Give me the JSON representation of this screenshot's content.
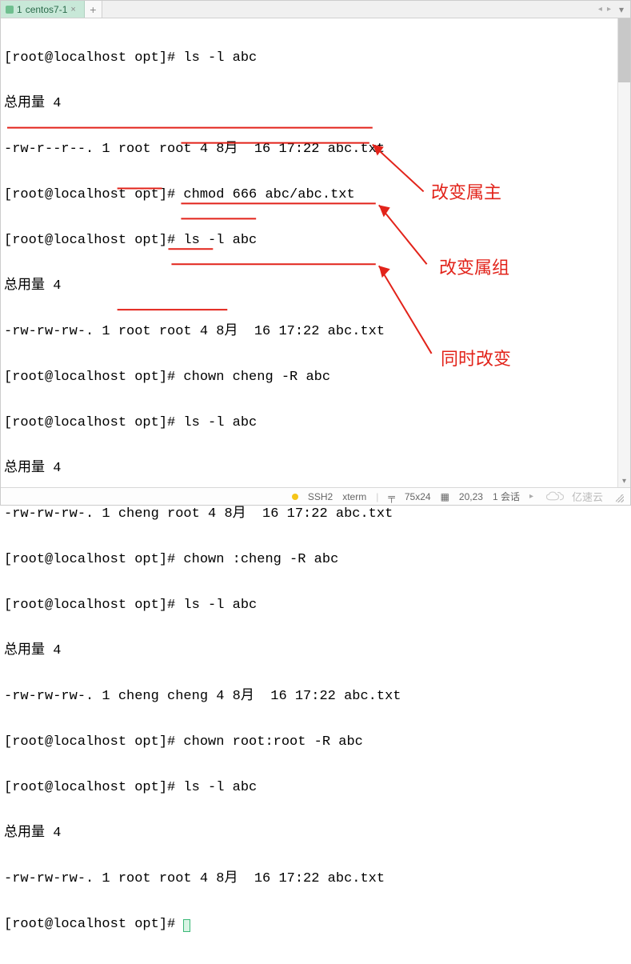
{
  "tab": {
    "index": "1",
    "title": "centos7-1"
  },
  "terminal": {
    "lines": [
      "[root@localhost opt]# ls -l abc",
      "总用量 4",
      "-rw-r--r--. 1 root root 4 8月  16 17:22 abc.txt",
      "[root@localhost opt]# chmod 666 abc/abc.txt",
      "[root@localhost opt]# ls -l abc",
      "总用量 4",
      "-rw-rw-rw-. 1 root root 4 8月  16 17:22 abc.txt",
      "[root@localhost opt]# chown cheng -R abc",
      "[root@localhost opt]# ls -l abc",
      "总用量 4",
      "-rw-rw-rw-. 1 cheng root 4 8月  16 17:22 abc.txt",
      "[root@localhost opt]# chown :cheng -R abc",
      "[root@localhost opt]# ls -l abc",
      "总用量 4",
      "-rw-rw-rw-. 1 cheng cheng 4 8月  16 17:22 abc.txt",
      "[root@localhost opt]# chown root:root -R abc",
      "[root@localhost opt]# ls -l abc",
      "总用量 4",
      "-rw-rw-rw-. 1 root root 4 8月  16 17:22 abc.txt",
      "[root@localhost opt]# "
    ]
  },
  "annotations": {
    "label_owner": "改变属主",
    "label_group": "改变属组",
    "label_both": "同时改变"
  },
  "status": {
    "conn": "SSH2",
    "term": "xterm",
    "size": "75x24",
    "pos": "20,23",
    "sess": "1 会话"
  },
  "watermark": "亿速云"
}
